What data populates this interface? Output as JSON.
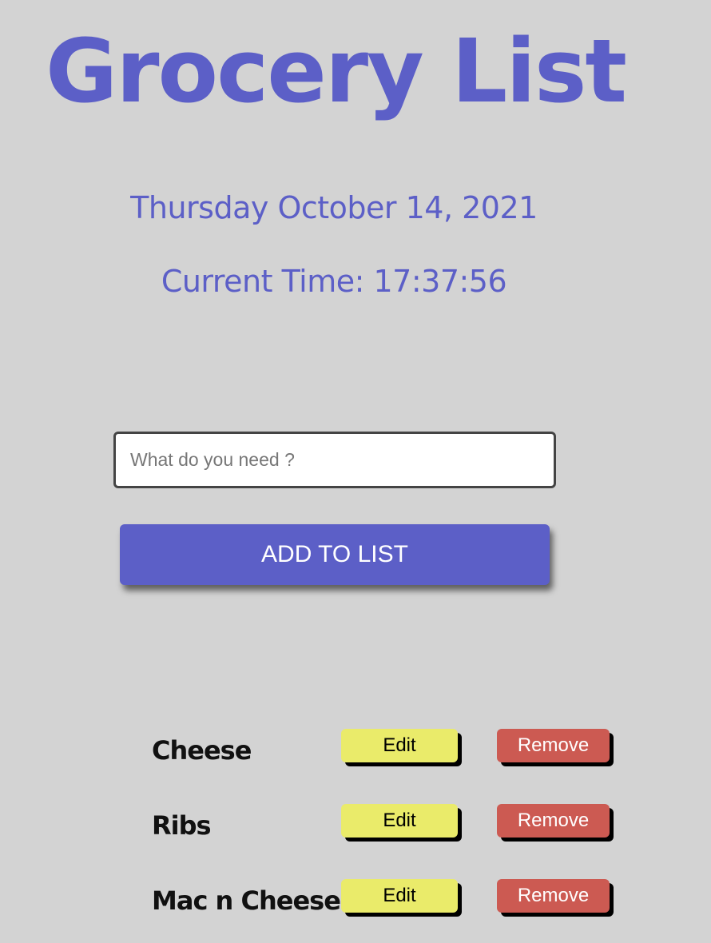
{
  "header": {
    "title": "Grocery List",
    "date": "Thursday October 14, 2021",
    "time": "Current Time: 17:37:56"
  },
  "form": {
    "input_placeholder": "What do you need ?",
    "input_value": "",
    "add_button_label": "ADD TO LIST"
  },
  "items": [
    {
      "name": "Cheese",
      "edit_label": "Edit",
      "remove_label": "Remove"
    },
    {
      "name": "Ribs",
      "edit_label": "Edit",
      "remove_label": "Remove"
    },
    {
      "name": "Mac n Cheese",
      "edit_label": "Edit",
      "remove_label": "Remove"
    }
  ],
  "colors": {
    "background": "#d3d3d3",
    "accent": "#5c5fc7",
    "edit_button": "#eaeb6a",
    "remove_button": "#cc5a52"
  }
}
